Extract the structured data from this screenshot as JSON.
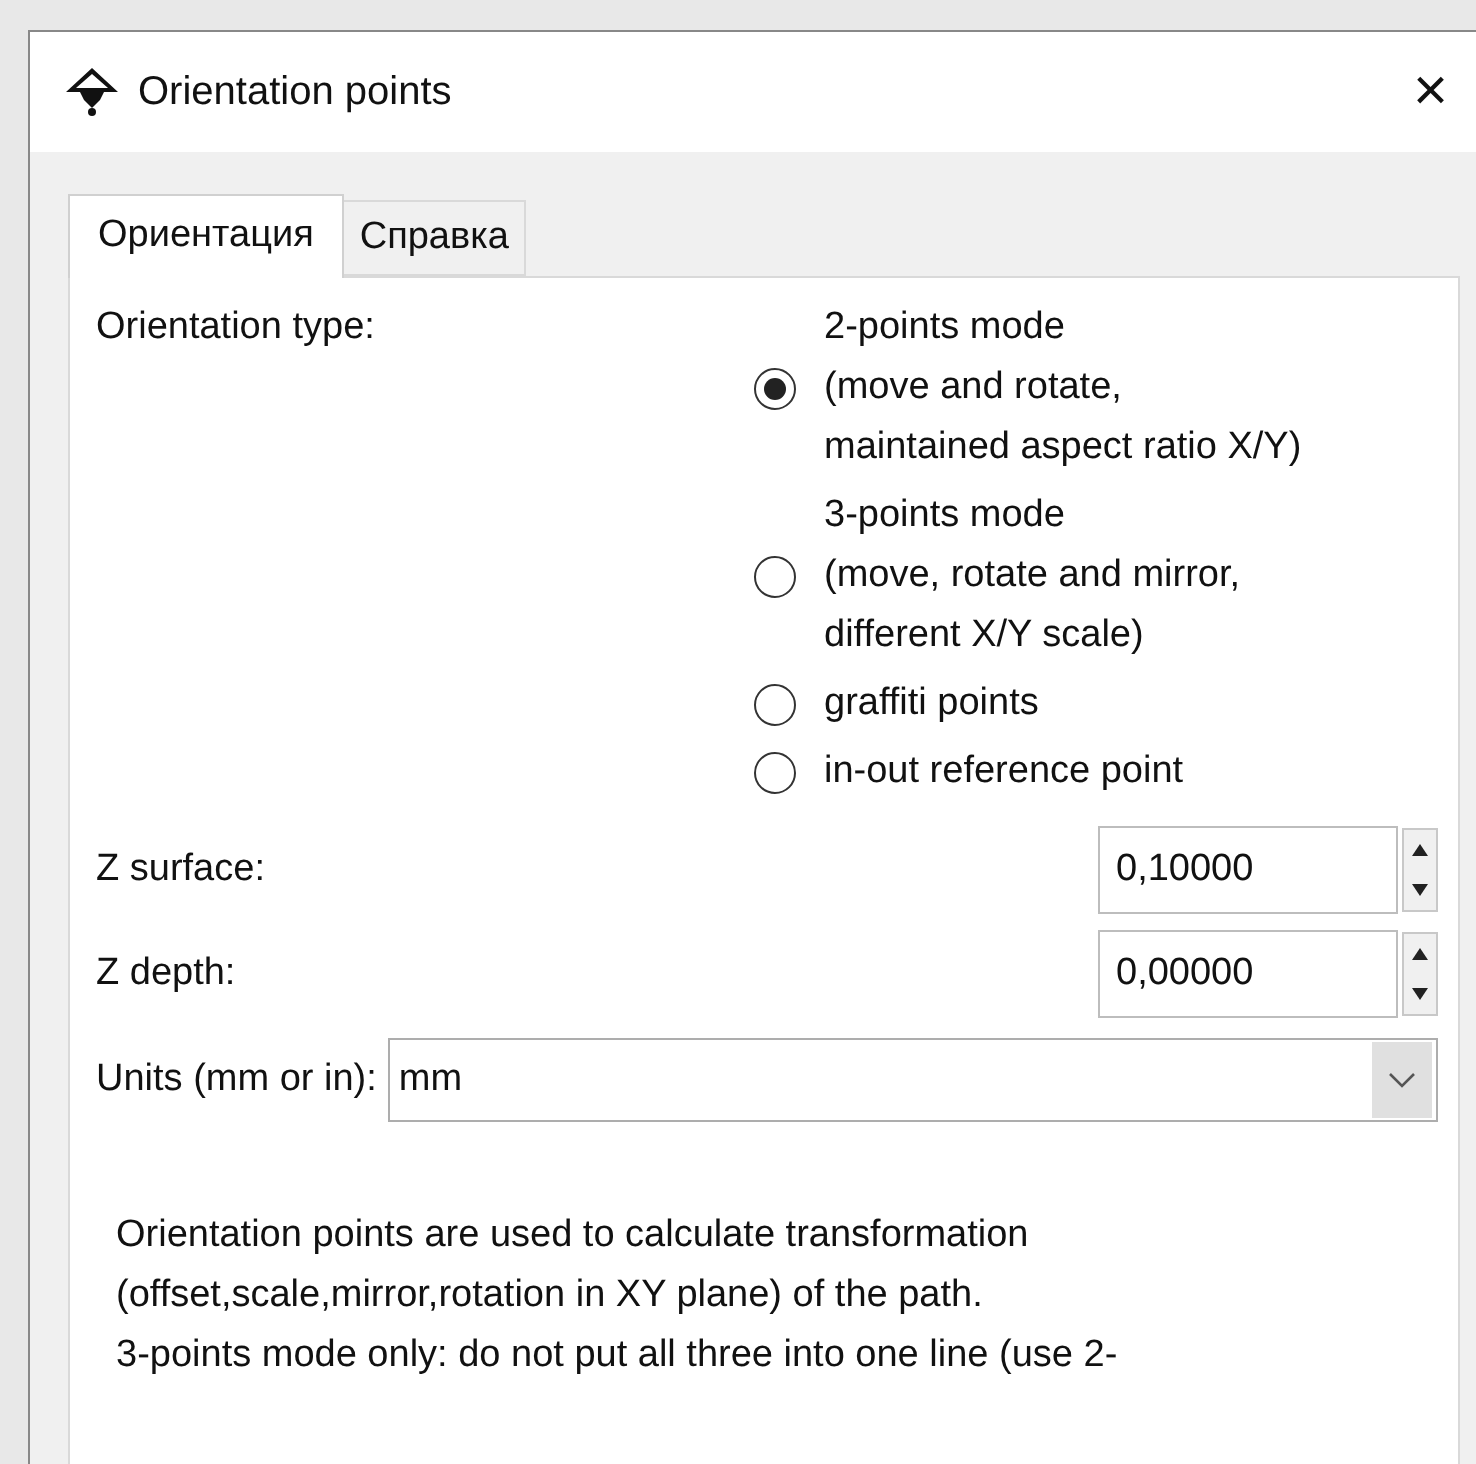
{
  "window": {
    "title": "Orientation points",
    "close": "×"
  },
  "tabs": [
    {
      "label": "Ориентация",
      "selected": true
    },
    {
      "label": "Справка",
      "selected": false
    }
  ],
  "orientation_type": {
    "label": "Orientation type:",
    "options": [
      {
        "lines": [
          "2-points mode",
          "(move and rotate,",
          "maintained aspect ratio X/Y)"
        ],
        "selected": true
      },
      {
        "lines": [
          "3-points mode",
          "(move, rotate and mirror,",
          "different X/Y scale)"
        ],
        "selected": false
      },
      {
        "lines": [
          "graffiti points"
        ],
        "selected": false
      },
      {
        "lines": [
          "in-out reference point"
        ],
        "selected": false
      }
    ]
  },
  "z_surface": {
    "label": "Z surface:",
    "value": "0,10000"
  },
  "z_depth": {
    "label": "Z depth:",
    "value": "0,00000"
  },
  "units": {
    "label": "Units (mm or in):",
    "value": "mm"
  },
  "description": [
    "Orientation points are used to calculate transformation",
    "(offset,scale,mirror,rotation in XY plane) of the path.",
    "3-points mode only: do not put all three into one line (use 2-"
  ]
}
